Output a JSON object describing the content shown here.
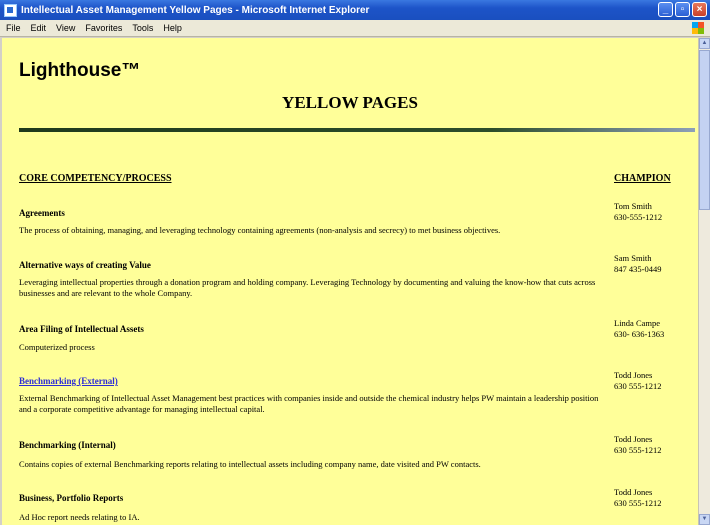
{
  "window": {
    "title": "Intellectual Asset Management Yellow Pages - Microsoft Internet Explorer"
  },
  "menu": [
    "File",
    "Edit",
    "View",
    "Favorites",
    "Tools",
    "Help"
  ],
  "page": {
    "brand": "Lighthouse™",
    "heading": "YELLOW PAGES",
    "col_process": "CORE COMPETENCY/PROCESS",
    "col_champion": "CHAMPION",
    "entries": [
      {
        "title": "Agreements",
        "desc": "The process of obtaining, managing, and leveraging technology containing agreements (non-analysis and secrecy) to met business objectives.",
        "champ_name": "Tom Smith",
        "champ_phone": "630-555-1212"
      },
      {
        "title": "Alternative ways of creating Value",
        "desc": "Leveraging intellectual properties through a donation program and holding company. Leveraging Technology by documenting and valuing the know-how that cuts across businesses and are relevant to the whole Company.",
        "champ_name": "Sam Smith",
        "champ_phone": "847 435-0449"
      },
      {
        "title": "Area Filing of Intellectual Assets",
        "desc": "Computerized process",
        "champ_name": "Linda Campe",
        "champ_phone": "630- 636-1363"
      },
      {
        "title": "Benchmarking (External)",
        "desc": "External Benchmarking of Intellectual Asset Management best practices with companies inside and outside the chemical industry helps PW maintain a leadership position and a corporate competitive advantage for managing intellectual capital.",
        "champ_name": "Todd Jones",
        "champ_phone": "630 555-1212"
      },
      {
        "title": "Benchmarking (Internal)",
        "desc": "Contains copies of external Benchmarking reports relating to intellectual assets including company name, date visited and PW contacts.",
        "champ_name": "Todd Jones",
        "champ_phone": "630 555-1212"
      },
      {
        "title": "Business, Portfolio Reports",
        "desc": "Ad Hoc report needs relating to IA.",
        "champ_name": "Todd Jones",
        "champ_phone": "630 555-1212"
      }
    ]
  }
}
